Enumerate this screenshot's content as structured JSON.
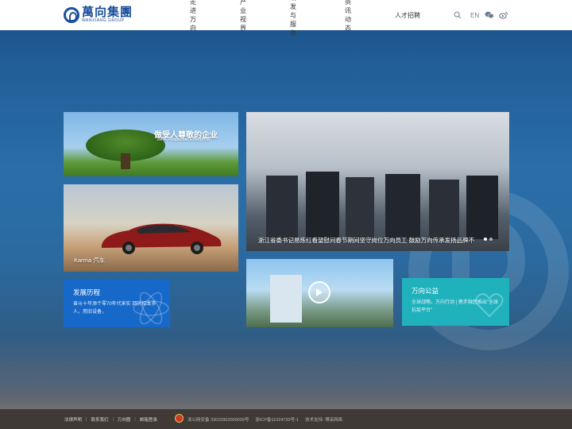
{
  "brand": {
    "name_cn": "萬向集團",
    "name_en": "WANXIANG GROUP",
    "color": "#1a4f9c"
  },
  "nav": {
    "items": [
      "走进万向",
      "产业视界",
      "研发与服务",
      "资讯动态",
      "人才招聘"
    ]
  },
  "tools": {
    "search_icon": "search-icon",
    "lang": "EN",
    "wechat_icon": "wechat-icon",
    "weibo_icon": "weibo-icon"
  },
  "tiles": {
    "enterprise": {
      "title": "做受人尊敬的企业",
      "subtitle": "Be A Respected Enterprise"
    },
    "karma": {
      "label": "Karma 汽车"
    },
    "news": {
      "caption": "浙江省委书记易炼红看望慰问春节期间坚守岗位万向员工 鼓励万向传承发扬品牌不"
    },
    "history": {
      "title": "发展历程",
      "text": "奋斗十年添个零70年代来实 回折招本多人，用旧设备，"
    },
    "charity": {
      "title": "万向公益",
      "text": "全球战略，万向行动 | 携手微医推出\"全球抗疫平台\""
    }
  },
  "footer": {
    "links": [
      "法律声明",
      "联系我们",
      "万向圈",
      "邮箱登录"
    ],
    "police_record": "浙公网安备 33010902000009号",
    "icp": "浙ICP备11024720号-1",
    "support": "技术支持: 博采网络"
  }
}
